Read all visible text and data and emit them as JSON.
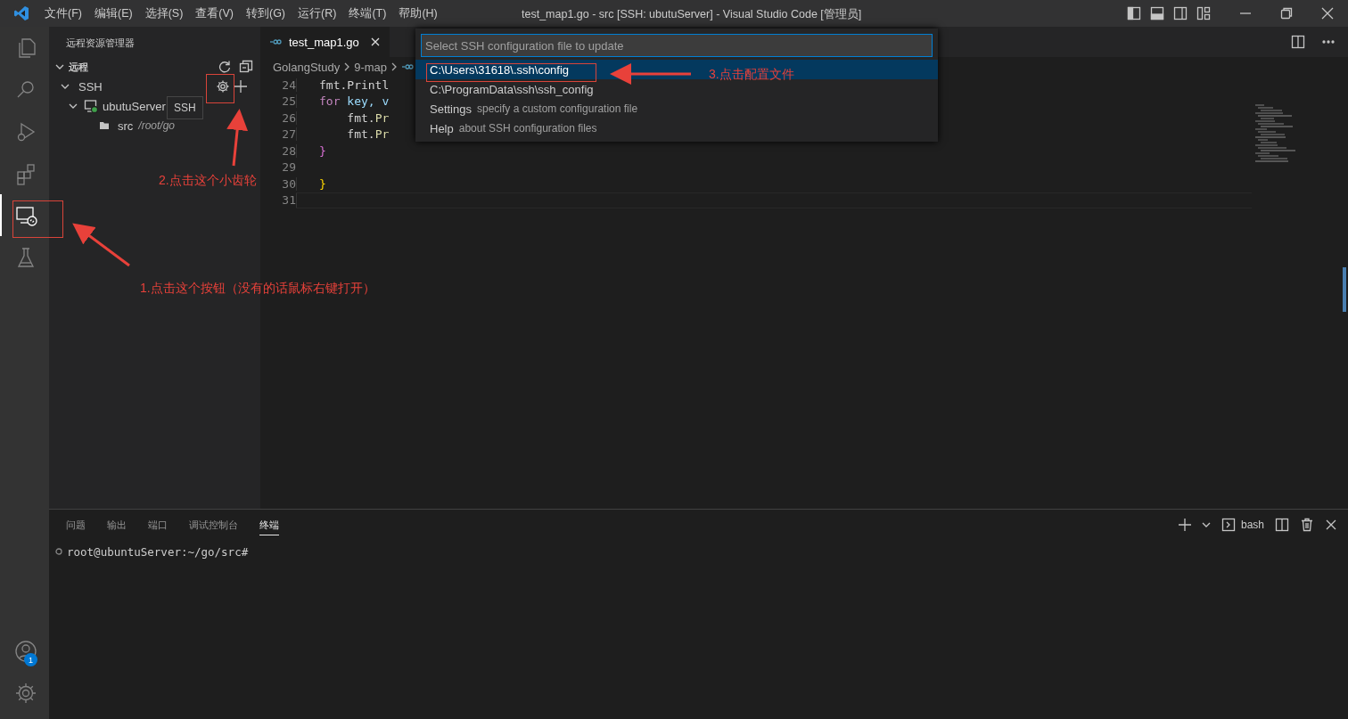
{
  "title_bar": {
    "menus": [
      "文件(F)",
      "编辑(E)",
      "选择(S)",
      "查看(V)",
      "转到(G)",
      "运行(R)",
      "终端(T)",
      "帮助(H)"
    ],
    "title": "test_map1.go - src [SSH: ubutuServer] - Visual Studio Code [管理员]"
  },
  "activity_bar": [
    {
      "kind": "files",
      "selected": false
    },
    {
      "kind": "search",
      "selected": false
    },
    {
      "kind": "debug",
      "selected": false
    },
    {
      "kind": "extensions",
      "selected": false
    },
    {
      "kind": "remote",
      "selected": true
    },
    {
      "kind": "testing",
      "selected": false
    }
  ],
  "account_badge": "1",
  "sidebar": {
    "title": "远程资源管理器",
    "section": "远程",
    "tree": [
      {
        "label": "SSH",
        "expanded": true,
        "kind": "group",
        "children": [
          {
            "label": "ubutuServer",
            "expanded": true,
            "kind": "host",
            "children": [
              {
                "label": "src",
                "description": "/root/go",
                "kind": "folder"
              }
            ]
          }
        ]
      }
    ],
    "tooltip": "SSH"
  },
  "editor": {
    "tabs": [
      {
        "label": "test_map1.go",
        "selected": true
      }
    ],
    "breadcrumb": [
      "GolangStudy",
      "9-map"
    ],
    "lines": [
      {
        "number": "24",
        "tokens": [
          {
            "text": "fmt.Printl",
            "kind": "plain"
          }
        ]
      },
      {
        "number": "25",
        "tokens": [
          {
            "text": "for",
            "kind": "keyword"
          },
          {
            "text": " key, v",
            "kind": "var"
          }
        ]
      },
      {
        "number": "26",
        "tokens": [
          {
            "text": "    fmt.",
            "kind": "plain"
          },
          {
            "text": "Pr",
            "kind": "func"
          }
        ]
      },
      {
        "number": "27",
        "tokens": [
          {
            "text": "    fmt.",
            "kind": "plain"
          },
          {
            "text": "Pr",
            "kind": "func"
          }
        ]
      },
      {
        "number": "28",
        "tokens": [
          {
            "text": "}",
            "kind": "bracket2"
          }
        ]
      },
      {
        "number": "29"
      },
      {
        "number": "30",
        "tokens": [
          {
            "text": "}",
            "kind": "bracket1"
          }
        ]
      },
      {
        "number": "31"
      }
    ]
  },
  "quick_pick": {
    "placeholder": "Select SSH configuration file to update",
    "items": [
      {
        "label": "C:\\Users\\31618\\.ssh\\config",
        "selected": true
      },
      {
        "label": "C:\\ProgramData\\ssh\\ssh_config",
        "selected": false
      },
      {
        "label": "Settings",
        "description": "specify a custom configuration file",
        "selected": false
      },
      {
        "label": "Help",
        "description": "about SSH configuration files",
        "selected": false
      }
    ]
  },
  "panel": {
    "tabs": [
      {
        "label": "问题",
        "selected": false
      },
      {
        "label": "输出",
        "selected": false
      },
      {
        "label": "端口",
        "selected": false
      },
      {
        "label": "调试控制台",
        "selected": false
      },
      {
        "label": "终端",
        "selected": true
      }
    ],
    "terminal_name": "bash",
    "terminal_line": "root@ubuntuServer:~/go/src#"
  },
  "annotations": [
    "3.点击配置文件",
    "2.点击这个小齿轮",
    "1.点击这个按钮（没有的话鼠标右键打开）"
  ]
}
